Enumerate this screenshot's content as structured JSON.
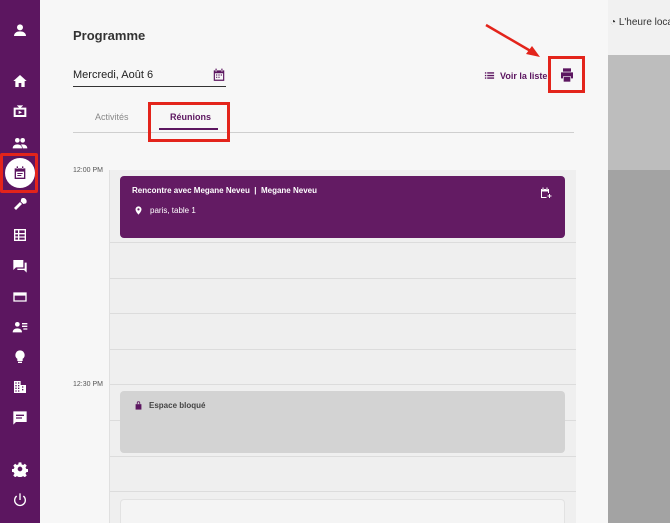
{
  "topbar": {
    "local_time_label": "L'heure locale"
  },
  "page": {
    "title": "Programme"
  },
  "date_picker": {
    "value": "Mercredi, Août 6"
  },
  "actions": {
    "list_view_label": "Voir la liste"
  },
  "tabs": [
    {
      "label": "Activités",
      "active": false
    },
    {
      "label": "Réunions",
      "active": true
    }
  ],
  "schedule": {
    "times": [
      "12:00 PM",
      "12:30 PM"
    ],
    "meeting": {
      "title": "Rencontre avec Megane Neveu  |  Megane Neveu",
      "location": "paris, table 1"
    },
    "blocked": {
      "label": "Espace bloqué"
    }
  },
  "sidebar": {
    "items": [
      {
        "icon": "user-icon"
      },
      {
        "icon": "home-icon"
      },
      {
        "icon": "tv-icon"
      },
      {
        "icon": "people-icon"
      },
      {
        "icon": "calendar-icon",
        "active": true
      },
      {
        "icon": "microphone-icon"
      },
      {
        "icon": "table-icon"
      },
      {
        "icon": "chat-icon"
      },
      {
        "icon": "card-icon"
      },
      {
        "icon": "contact-icon"
      },
      {
        "icon": "lightbulb-icon"
      },
      {
        "icon": "building-icon"
      },
      {
        "icon": "message-icon"
      },
      {
        "icon": "gear-icon"
      },
      {
        "icon": "power-icon"
      }
    ]
  },
  "colors": {
    "brand": "#5c1660",
    "annotation": "#e3241b"
  }
}
